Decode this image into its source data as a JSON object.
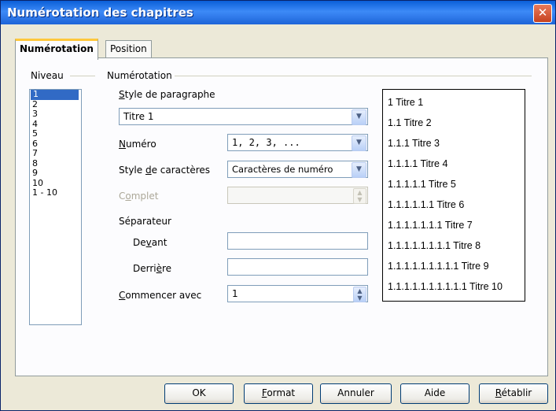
{
  "window": {
    "title": "Numérotation des chapitres"
  },
  "tabs": [
    {
      "label": "Numérotation",
      "active": true
    },
    {
      "label": "Position",
      "active": false
    }
  ],
  "niveau": {
    "legend": "Niveau",
    "items": [
      "1",
      "2",
      "3",
      "4",
      "5",
      "6",
      "7",
      "8",
      "9",
      "10",
      "1 - 10"
    ],
    "selected": "1"
  },
  "numerotation": {
    "legend": "Numérotation",
    "style_paragraphe_label": "Style de paragraphe",
    "style_paragraphe_value": "Titre 1",
    "numero_label": "Numéro",
    "numero_value": "1, 2, 3, ...",
    "style_caracteres_label": "Style de caractères",
    "style_caracteres_value": "Caractères de numéro",
    "complet_label": "Complet",
    "separateur_label": "Séparateur",
    "devant_label": "Devant",
    "devant_value": "",
    "derriere_label": "Derrière",
    "derriere_value": "",
    "commencer_label": "Commencer avec",
    "commencer_value": "1"
  },
  "preview": [
    "1  Titre 1",
    "1.1  Titre 2",
    "1.1.1  Titre 3",
    "1.1.1.1  Titre 4",
    "1.1.1.1.1  Titre 5",
    "1.1.1.1.1.1  Titre 6",
    "1.1.1.1.1.1.1  Titre 7",
    "1.1.1.1.1.1.1.1  Titre 8",
    "1.1.1.1.1.1.1.1.1  Titre 9",
    "1.1.1.1.1.1.1.1.1.1  Titre 10"
  ],
  "buttons": {
    "ok": "OK",
    "format": "Format",
    "annuler": "Annuler",
    "aide": "Aide",
    "retablir": "Rétablir"
  },
  "colors": {
    "titlebar": "#0A5FD8",
    "selection": "#316AC5",
    "tab_highlight": "#FFC83C"
  },
  "icons": {
    "close": "close-icon",
    "dropdown": "chevron-down-icon",
    "spinner": "spin-arrows-icon"
  }
}
